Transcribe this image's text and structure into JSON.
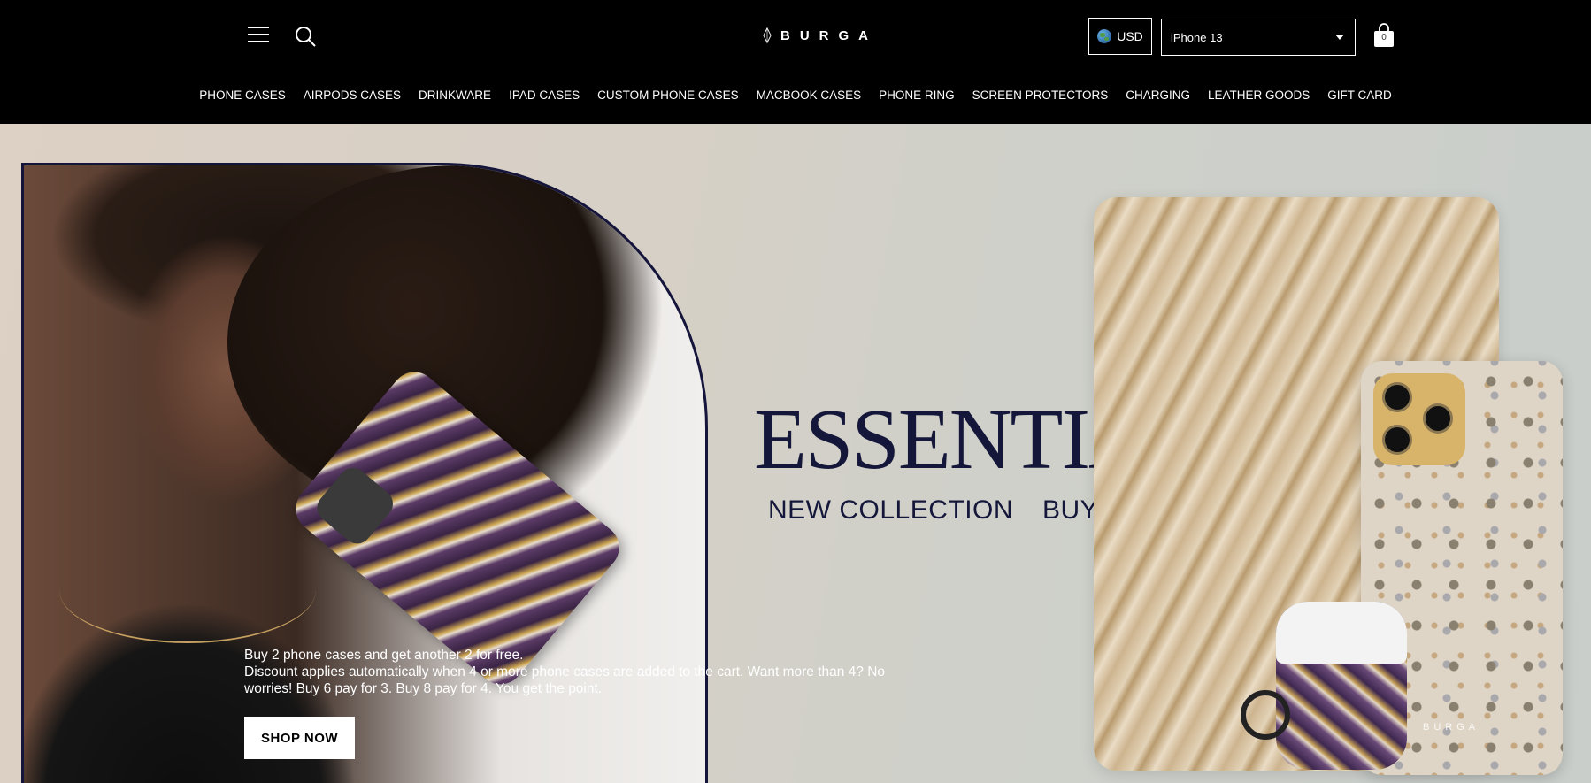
{
  "header": {
    "logo_text": "BURGA",
    "currency": "USD",
    "selected_model": "iPhone 13",
    "cart_count": "0",
    "icons": [
      "menu-icon",
      "search-icon",
      "logo-mark-icon",
      "globe-icon",
      "chevron-down-icon",
      "cart-icon"
    ]
  },
  "nav": {
    "items": [
      {
        "label": "PHONE CASES"
      },
      {
        "label": "AIRPODS CASES"
      },
      {
        "label": "DRINKWARE"
      },
      {
        "label": "IPAD CASES"
      },
      {
        "label": "CUSTOM PHONE CASES"
      },
      {
        "label": "MACBOOK CASES"
      },
      {
        "label": "PHONE RING"
      },
      {
        "label": "SCREEN PROTECTORS"
      },
      {
        "label": "CHARGING"
      },
      {
        "label": "LEATHER GOODS"
      },
      {
        "label": "GIFT CARD"
      }
    ]
  },
  "hero": {
    "headline": "ESSENTIALS",
    "subheading_left": "NEW COLLECTION",
    "subheading_right": "BUY 2 GET 2 FREE",
    "case_brand": "BURGA",
    "promo_line1": "Buy 2 phone cases and get another 2 for free.",
    "promo_line2": "Discount applies automatically when 4 or more phone cases are added to the cart. Want more than 4? No worries! Buy 6 pay for 3. Buy 8 pay for 4. You get the point.",
    "cta_label": "SHOP NOW"
  },
  "colors": {
    "header_bg": "#000000",
    "headline_navy": "#14173a",
    "hero_bg": "#d6d0c6"
  }
}
